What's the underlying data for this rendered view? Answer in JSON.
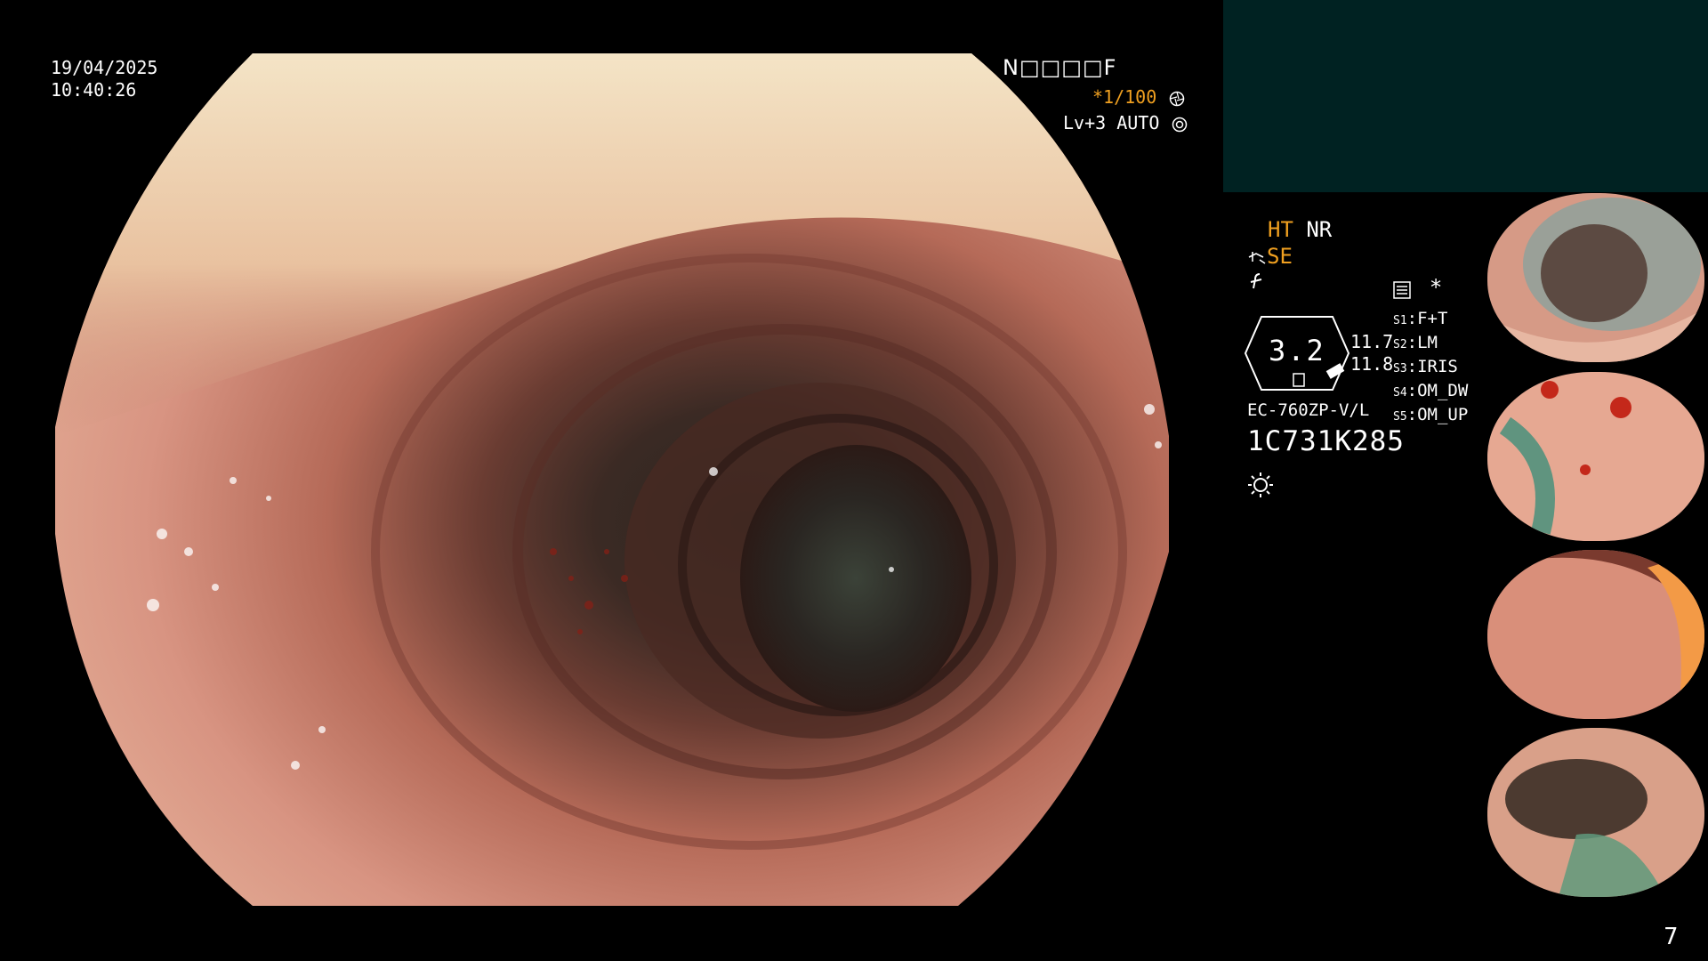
{
  "overlay": {
    "date": "19/04/2025",
    "time": "10:40:26",
    "name_field": "N□□□□F",
    "shutter": "*1/100",
    "shutter_icon": "aperture-icon",
    "level": "Lv+3 AUTO",
    "level_icon": "auto-target-icon"
  },
  "right_panel": {
    "ht": "HT",
    "nr": "NR",
    "se": "SE",
    "enhance_icon": "enhance-icon",
    "f_icon": "f-symbol-icon",
    "gauge_value": "3.2",
    "gauge_top": "11.7",
    "gauge_bottom": "11.8",
    "model": "EC-760ZP-V/L",
    "serial": "1C731K285",
    "light_icon": "sun-icon",
    "list_icon": "list-icon",
    "asterisk": "*",
    "settings": [
      {
        "slot": "S1",
        "value": "F+T"
      },
      {
        "slot": "S2",
        "value": "LM"
      },
      {
        "slot": "S3",
        "value": "IRIS"
      },
      {
        "slot": "S4",
        "value": "OM_DW"
      },
      {
        "slot": "S5",
        "value": "OM_UP"
      }
    ]
  },
  "page_number": "7",
  "colors": {
    "accent_orange": "#f0a020",
    "panel_teal": "#002222",
    "background": "#000000"
  }
}
